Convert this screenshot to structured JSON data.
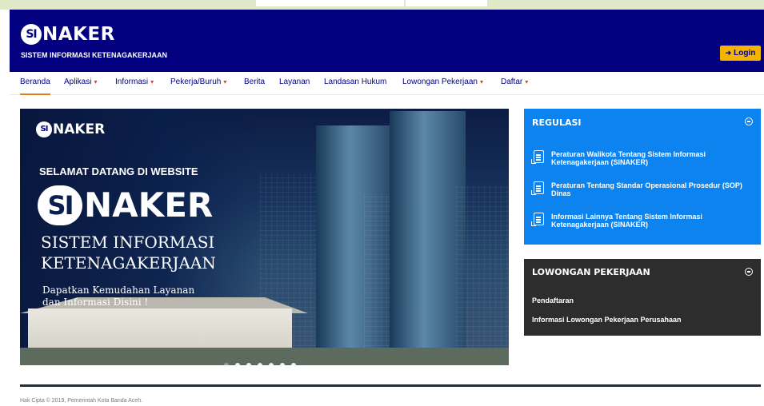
{
  "brand": {
    "logo_si": "SI",
    "logo_rest": "NAKER",
    "tagline": "SISTEM INFORMASI KETENAGAKERJAAN"
  },
  "header": {
    "login_label": "Login",
    "login_icon": "sign-in-icon"
  },
  "nav": {
    "items": [
      {
        "label": "Beranda",
        "dropdown": false,
        "active": true
      },
      {
        "label": "Aplikasi",
        "dropdown": true
      },
      {
        "label": "Informasi",
        "dropdown": true
      },
      {
        "label": "Pekerja/Buruh",
        "dropdown": true
      },
      {
        "label": "Berita",
        "dropdown": false
      },
      {
        "label": "Layanan",
        "dropdown": false
      },
      {
        "label": "Landasan Hukum",
        "dropdown": false
      },
      {
        "label": "Lowongan Pekerjaan",
        "dropdown": true
      },
      {
        "label": "Daftar",
        "dropdown": true
      }
    ],
    "caret": "▾"
  },
  "slider": {
    "logo_si": "SI",
    "logo_rest": "NAKER",
    "welcome": "SELAMAT DATANG DI WEBSITE",
    "brand_si": "SI",
    "brand_rest": "NAKER",
    "title_line1": "SISTEM INFORMASI",
    "title_line2": "KETENAGAKERJAAN",
    "subtitle_line1": "Dapatkan Kemudahan Layanan",
    "subtitle_line2": "dan Informasi  Disini !",
    "slide_count": 7,
    "active_slide": 1
  },
  "regulasi": {
    "title": "REGULASI",
    "items": [
      {
        "icon": "document-icon",
        "text": "Peraturan Walikota Tentang Sistem Informasi Ketenagakerjaan (SINAKER)"
      },
      {
        "icon": "document-icon",
        "text": "Peraturan Tentang Standar Operasional Prosedur (SOP) Dinas"
      },
      {
        "icon": "document-icon",
        "text": "Informasi Lainnya Tentang Sistem Informasi Ketenagakerjaan (SINAKER)"
      }
    ]
  },
  "lowongan": {
    "title": "LOWONGAN PEKERJAAN",
    "items": [
      "Pendaftaran",
      "Informasi Lowongan Pekerjaan Perusahaan"
    ]
  },
  "footer": {
    "copyright": "Hak Cipta © 2019, Pemerintah Kota Banda Aceh."
  },
  "colors": {
    "header_bg": "#02007f",
    "login_bg": "#f4b400",
    "regulasi_bg": "#0d83f0",
    "lowongan_bg": "#2d2d2d",
    "nav_caret": "#d9412a",
    "nav_active_underline": "#e07b16"
  }
}
